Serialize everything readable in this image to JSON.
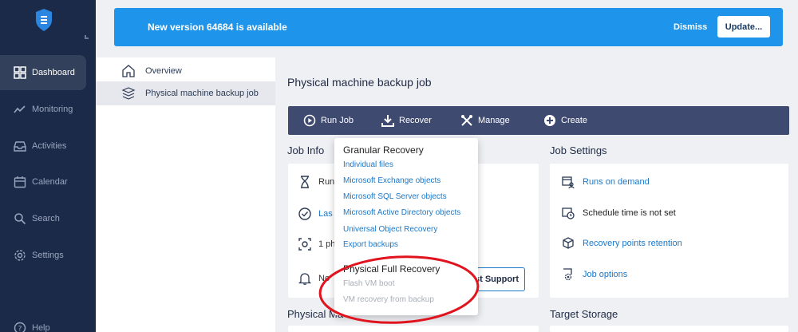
{
  "banner": {
    "message": "New version 64684 is available",
    "dismiss_label": "Dismiss",
    "update_label": "Update..."
  },
  "nav": {
    "items": [
      {
        "label": "Dashboard",
        "icon": "dashboard-icon",
        "active": true
      },
      {
        "label": "Monitoring",
        "icon": "monitoring-icon"
      },
      {
        "label": "Activities",
        "icon": "activities-icon"
      },
      {
        "label": "Calendar",
        "icon": "calendar-icon"
      },
      {
        "label": "Search",
        "icon": "search-icon"
      },
      {
        "label": "Settings",
        "icon": "settings-icon"
      },
      {
        "label": "Help",
        "icon": "help-icon"
      }
    ]
  },
  "tree": {
    "items": [
      {
        "label": "Overview",
        "icon": "home-icon"
      },
      {
        "label": "Physical machine backup job",
        "icon": "backup-job-icon",
        "selected": true
      }
    ]
  },
  "page": {
    "title": "Physical machine backup job"
  },
  "toolbar": {
    "run_job": "Run Job",
    "recover": "Recover",
    "manage": "Manage",
    "create": "Create"
  },
  "job_info": {
    "title": "Job Info",
    "rows": [
      "Run",
      "Las",
      "1 ph",
      "No"
    ],
    "support_button": "st Support"
  },
  "job_settings": {
    "title": "Job Settings",
    "rows": [
      {
        "label": "Runs on demand",
        "link": true,
        "icon": "calendar-user-icon"
      },
      {
        "label": "Schedule time is not set",
        "link": false,
        "icon": "schedule-clock-icon"
      },
      {
        "label": "Recovery points retention",
        "link": true,
        "icon": "cube-icon"
      },
      {
        "label": "Job options",
        "link": true,
        "icon": "gear-doc-icon"
      }
    ]
  },
  "bottom": {
    "physical_machines": "Physical Ma",
    "target_storage": "Target Storage"
  },
  "recover_menu": {
    "granular_heading": "Granular Recovery",
    "granular_items": [
      "Individual files",
      "Microsoft Exchange objects",
      "Microsoft SQL Server objects",
      "Microsoft Active Directory objects",
      "Universal Object Recovery",
      "Export backups"
    ],
    "full_heading": "Physical Full Recovery",
    "full_items": [
      "Flash VM boot",
      "VM recovery from backup"
    ]
  },
  "colors": {
    "rail": "#1c2a4a",
    "banner": "#1e94ea",
    "toolbar": "#3f4a70",
    "link": "#1b78c8",
    "annotation": "#e0141e"
  }
}
